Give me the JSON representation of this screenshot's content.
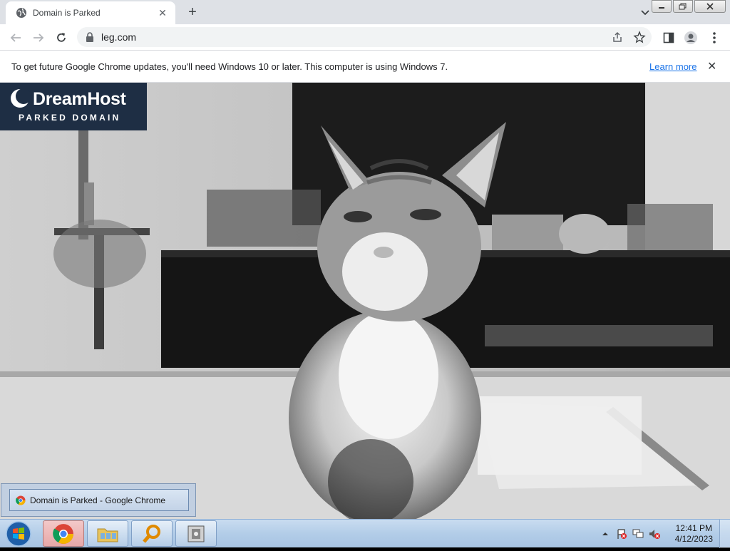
{
  "browser": {
    "tab": {
      "title": "Domain is Parked",
      "close_icon": "close-icon"
    },
    "new_tab_symbol": "+",
    "address": {
      "url": "leg.com"
    }
  },
  "infobar": {
    "message": "To get future Google Chrome updates, you'll need Windows 10 or later. This computer is using Windows 7.",
    "learn_more": "Learn more",
    "close_symbol": "✕"
  },
  "page": {
    "logo": {
      "name": "DreamHost",
      "subtitle": "PARKED DOMAIN",
      "background": "#1e2e44"
    }
  },
  "taskbar": {
    "preview_title": "Domain is Parked - Google Chrome",
    "items": [
      "chrome-icon",
      "folder-icon",
      "search-tool-icon",
      "disk-icon"
    ],
    "clock": {
      "time": "12:41 PM",
      "date": "4/12/2023"
    }
  }
}
